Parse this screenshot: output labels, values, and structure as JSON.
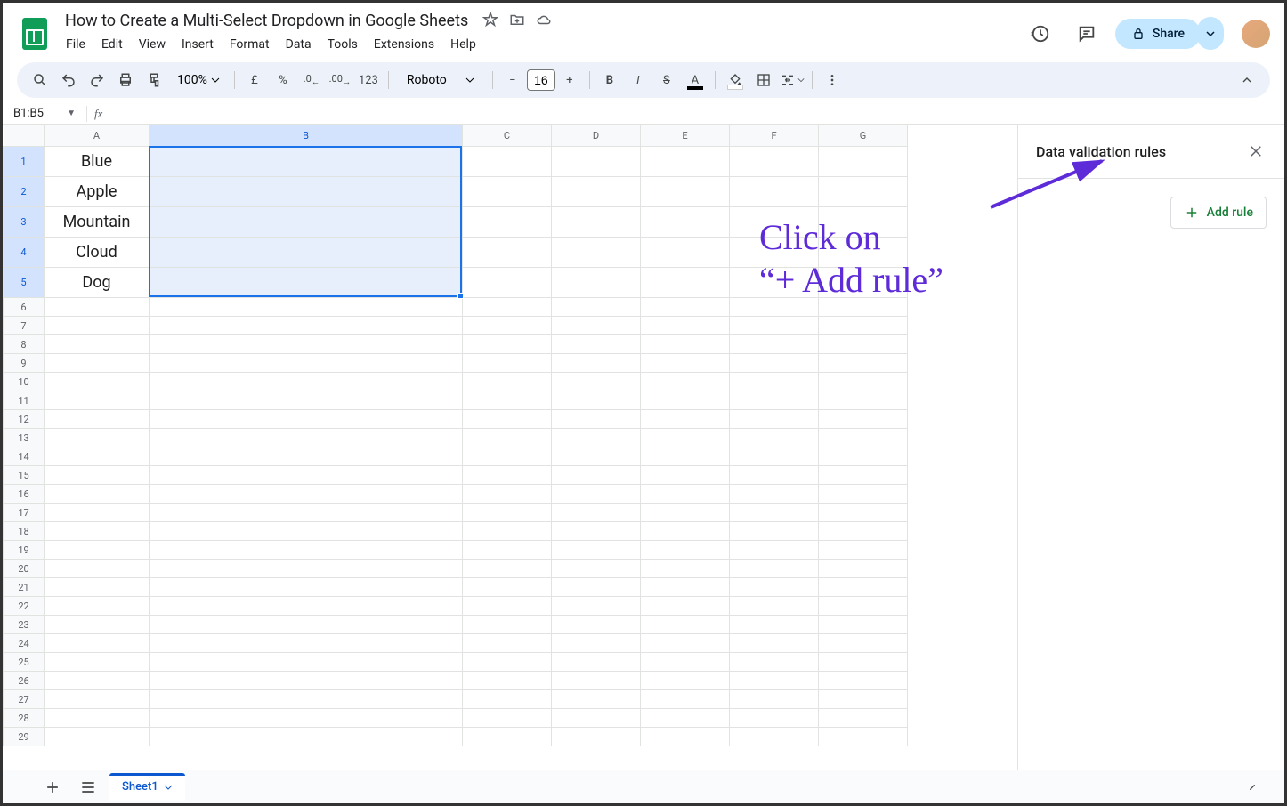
{
  "doc_title": "How to Create a Multi-Select Dropdown in Google Sheets",
  "menu": [
    "File",
    "Edit",
    "View",
    "Insert",
    "Format",
    "Data",
    "Tools",
    "Extensions",
    "Help"
  ],
  "share_label": "Share",
  "toolbar": {
    "zoom": "100%",
    "currency": "£",
    "percent": "%",
    "dec_dec": ".0",
    "inc_dec": ".00",
    "num_fmt": "123",
    "font": "Roboto",
    "font_size": "16"
  },
  "name_box": "B1:B5",
  "columns": [
    "A",
    "B",
    "C",
    "D",
    "E",
    "F",
    "G"
  ],
  "sel_col": "B",
  "sel_rows": [
    1,
    2,
    3,
    4,
    5
  ],
  "col_a_data": [
    "Blue",
    "Apple",
    "Mountain",
    "Cloud",
    "Dog"
  ],
  "row_count": 29,
  "side_panel": {
    "title": "Data validation rules",
    "add_rule": "Add rule"
  },
  "sheet_tab": "Sheet1",
  "annotation": {
    "line1": "Click on",
    "line2": "“+ Add rule”"
  }
}
